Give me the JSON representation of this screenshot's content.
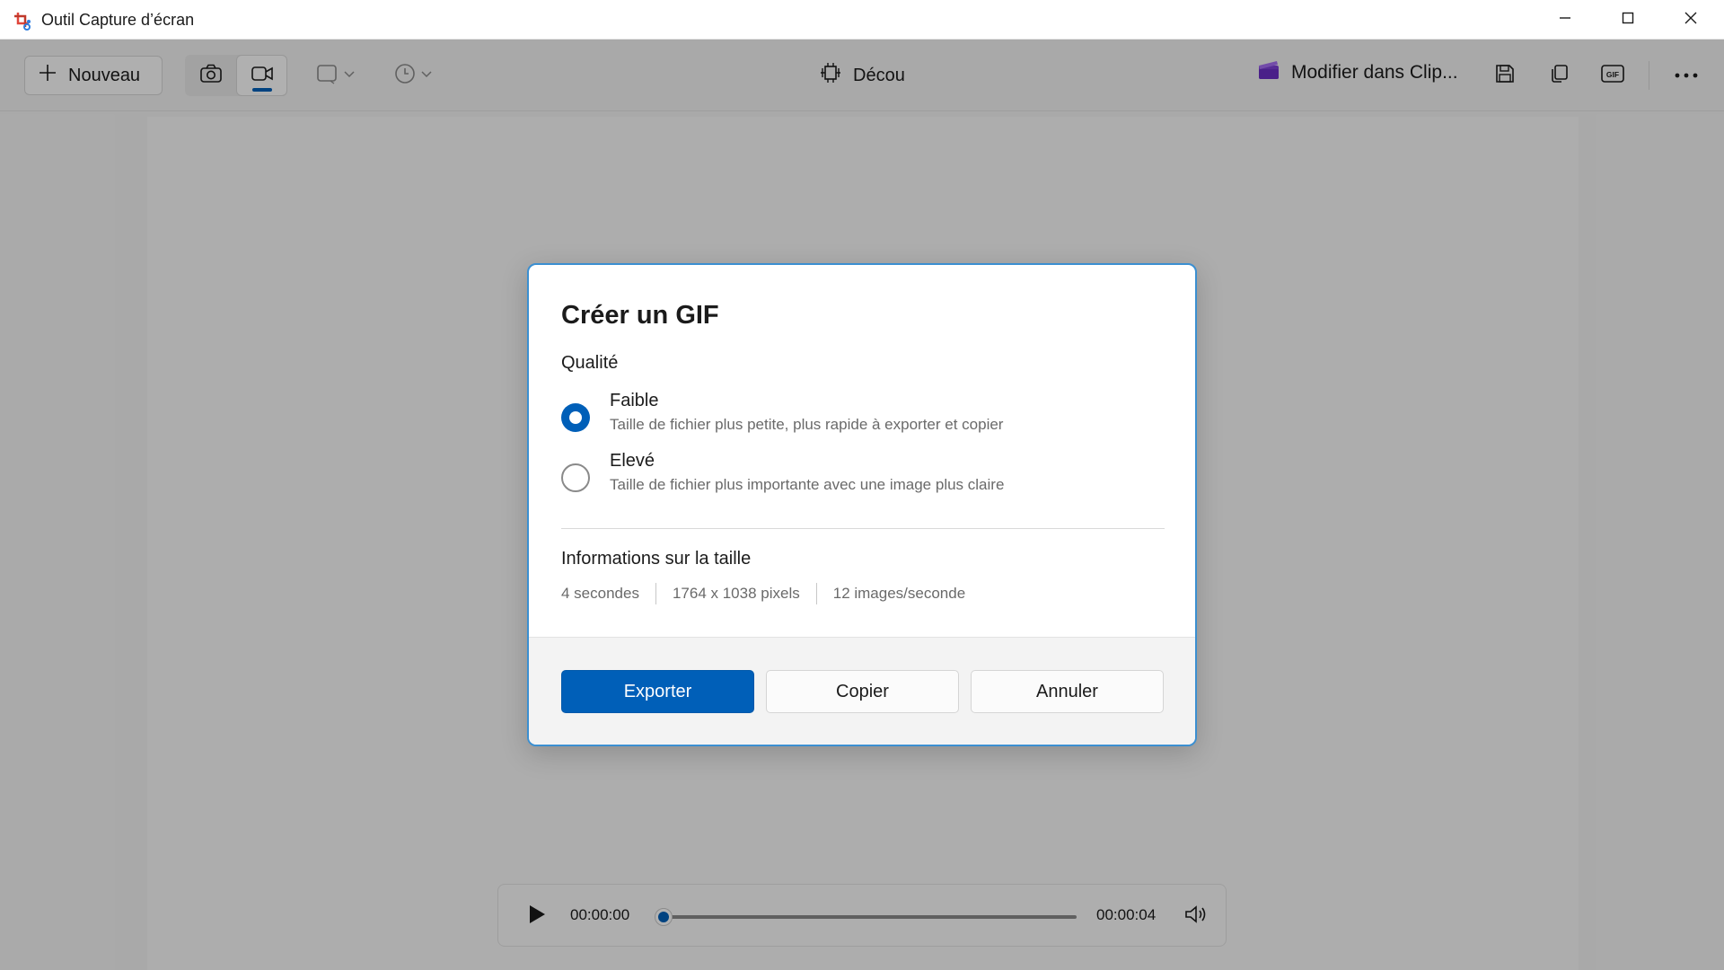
{
  "window": {
    "title": "Outil Capture d’écran",
    "controls": [
      "minimize",
      "maximize",
      "close"
    ]
  },
  "toolbar": {
    "new_label": "Nouveau",
    "modes": [
      {
        "icon": "camera-icon",
        "active": false
      },
      {
        "icon": "video-camera-icon",
        "active": true
      }
    ],
    "shape_icon": "rectangle-select-icon",
    "delay_icon": "clock-icon",
    "center_tool_label": "Décou",
    "clipchamp_label": "Modifier dans Clip...",
    "actions": [
      "save-icon",
      "copy-icon",
      "gif-icon",
      "more-icon"
    ]
  },
  "dialog": {
    "title": "Créer un GIF",
    "quality_label": "Qualité",
    "options": [
      {
        "label": "Faible",
        "desc": "Taille de fichier plus petite, plus rapide à exporter et copier",
        "checked": true
      },
      {
        "label": "Elevé",
        "desc": "Taille de fichier plus importante avec une image plus claire",
        "checked": false
      }
    ],
    "info_title": "Informations sur la taille",
    "info": {
      "duration": "4 secondes",
      "dimensions": "1764 x 1038 pixels",
      "framerate": "12 images/seconde"
    },
    "buttons": {
      "export": "Exporter",
      "copy": "Copier",
      "cancel": "Annuler"
    }
  },
  "player": {
    "current_time": "00:00:00",
    "total_time": "00:00:04",
    "progress": 0.0
  },
  "colors": {
    "accent": "#005fb8",
    "dialog_border": "#3b8fd1",
    "overlay": "rgba(0,0,0,0.30)"
  }
}
